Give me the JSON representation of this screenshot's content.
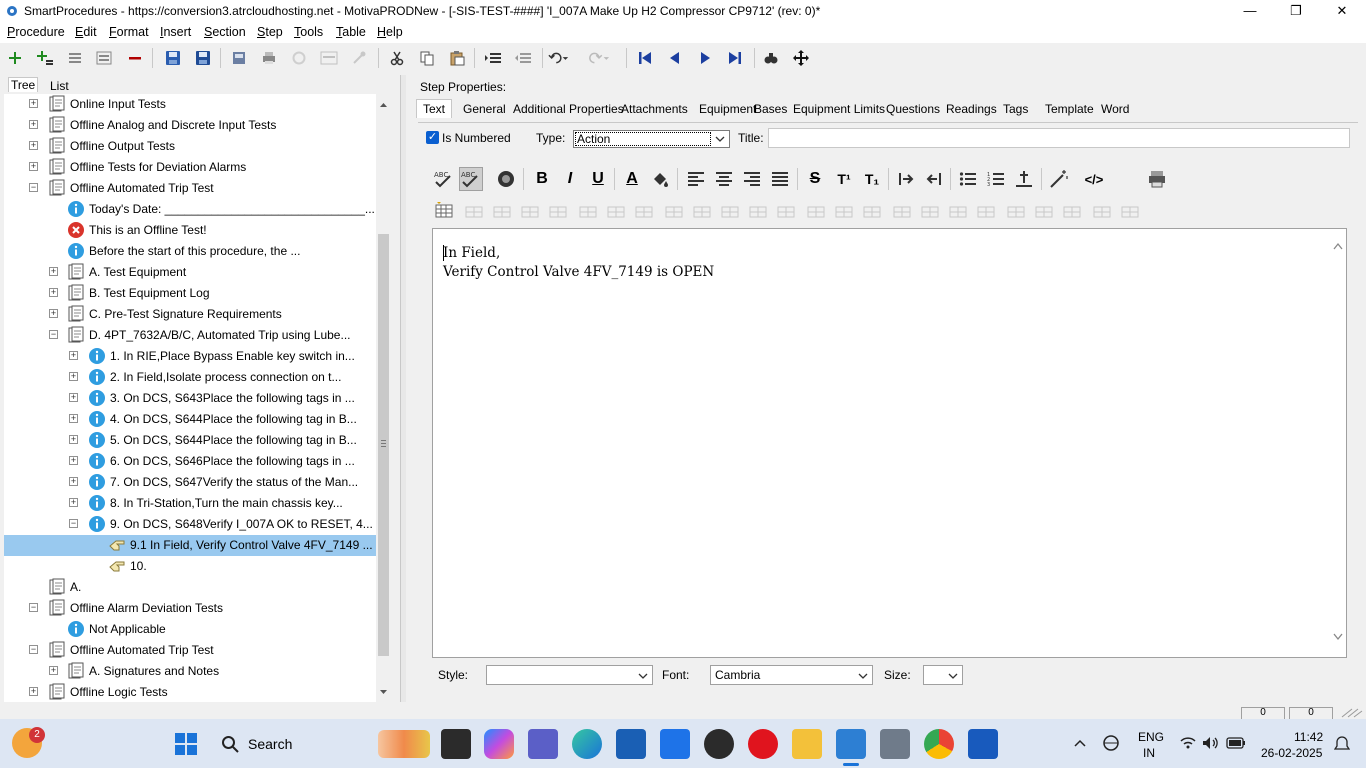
{
  "window": {
    "title": "SmartProcedures - https://conversion3.atrcloudhosting.net - MotivaPRODNew - [-SIS-TEST-####] 'I_007A Make Up H2 Compressor CP9712' (rev: 0)*",
    "minimize_glyph": "—",
    "maximize_glyph": "❐",
    "close_glyph": "✕"
  },
  "menu": {
    "items": [
      {
        "key": "P",
        "rest": "rocedure"
      },
      {
        "key": "E",
        "rest": "dit"
      },
      {
        "key": "F",
        "rest": "ormat"
      },
      {
        "key": "I",
        "rest": "nsert"
      },
      {
        "key": "S",
        "rest": "ection"
      },
      {
        "key": "S",
        "rest": "tep"
      },
      {
        "key": "T",
        "rest": "ools"
      },
      {
        "key": "T",
        "rest": "able"
      },
      {
        "key": "H",
        "rest": "elp"
      }
    ]
  },
  "left_tabs": {
    "tree": "Tree",
    "list": "List"
  },
  "tree": {
    "rows": [
      {
        "label": "Online Input Tests",
        "toggle": "+"
      },
      {
        "label": "Offline Analog and Discrete Input Tests",
        "toggle": "+"
      },
      {
        "label": "Offline Output Tests",
        "toggle": "+"
      },
      {
        "label": "Offline Tests for Deviation Alarms",
        "toggle": "+"
      },
      {
        "label": "Offline Automated Trip Test",
        "toggle": "−"
      },
      {
        "label": "Today's Date: ______________________________..."
      },
      {
        "label": "This is an Offline Test!"
      },
      {
        "label": "Before the start of this procedure, the ..."
      },
      {
        "label": "A. Test Equipment",
        "toggle": "+"
      },
      {
        "label": "B. Test Equipment Log",
        "toggle": "+"
      },
      {
        "label": "C. Pre-Test Signature Requirements",
        "toggle": "+"
      },
      {
        "label": "D. 4PT_7632A/B/C, Automated Trip using Lube...",
        "toggle": "−"
      },
      {
        "label": "1. In RIE,Place Bypass Enable key switch in...",
        "toggle": "+"
      },
      {
        "label": "2. In Field,Isolate process connection on t...",
        "toggle": "+"
      },
      {
        "label": "3. On DCS, S643Place the following tags in ...",
        "toggle": "+"
      },
      {
        "label": "4. On DCS, S644Place the following tag in B...",
        "toggle": "+"
      },
      {
        "label": "5. On DCS, S644Place the following tag in B...",
        "toggle": "+"
      },
      {
        "label": "6. On DCS, S646Place the following tags in ...",
        "toggle": "+"
      },
      {
        "label": "7. On DCS, S647Verify the status of the Man...",
        "toggle": "+"
      },
      {
        "label": "8. In Tri-Station,Turn the main chassis key...",
        "toggle": "+"
      },
      {
        "label": "9. On DCS, S648Verify I_007A OK to RESET, 4...",
        "toggle": "−"
      },
      {
        "label": "9.1 In Field, Verify Control Valve 4FV_7149 ..."
      },
      {
        "label": "10."
      },
      {
        "label": "A."
      },
      {
        "label": "Offline Alarm Deviation Tests",
        "toggle": "−"
      },
      {
        "label": "Not Applicable"
      },
      {
        "label": "Offline Automated Trip Test",
        "toggle": "−"
      },
      {
        "label": "A. Signatures and Notes",
        "toggle": "+"
      },
      {
        "label": "Offline Logic Tests",
        "toggle": "+"
      }
    ]
  },
  "step_properties": {
    "heading": "Step Properties:",
    "tabs": [
      "Text",
      "General",
      "Additional Properties",
      "Attachments",
      "Equipment",
      "Bases",
      "Equipment Limits",
      "Questions",
      "Readings",
      "Tags",
      "Template",
      "Word"
    ],
    "is_numbered_label": "Is Numbered",
    "type_label": "Type:",
    "type_value": "Action",
    "title_label": "Title:",
    "title_value": ""
  },
  "editor": {
    "lines": [
      "In Field,",
      "Verify Control Valve 4FV_7149 is OPEN"
    ]
  },
  "format_bar": {
    "bold": "B",
    "italic": "I",
    "underline": "U",
    "font_color": "A",
    "strike": "S",
    "superscript": "T¹",
    "subscript": "T₁",
    "html": "</>"
  },
  "bottom": {
    "style_label": "Style:",
    "style_value": "",
    "font_label": "Font:",
    "font_value": "Cambria",
    "size_label": "Size:",
    "size_value": ""
  },
  "status": {
    "counter_1": "0",
    "counter_2": "0"
  },
  "taskbar": {
    "notification_count": "2",
    "search_label": "Search",
    "lang_top": "ENG",
    "lang_bottom": "IN",
    "time": "11:42",
    "date": "26-02-2025"
  }
}
